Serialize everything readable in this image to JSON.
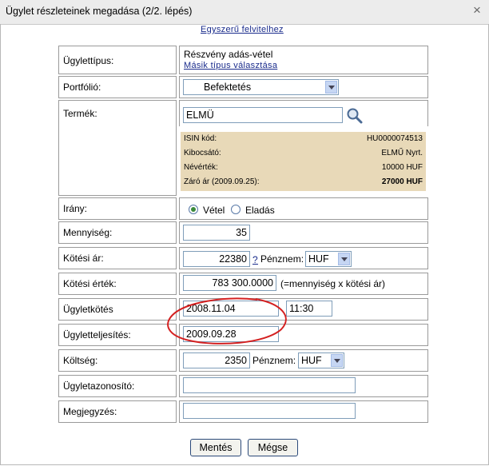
{
  "window": {
    "title": "Ügylet részleteinek megadása (2/2. lépés)",
    "close": "×"
  },
  "simple_link": "Egyszerű felvitelhez",
  "fields": {
    "type": {
      "label": "Ügylettípus:",
      "value": "Részvény adás-vétel",
      "link": "Másik típus választása"
    },
    "portfolio": {
      "label": "Portfólió:",
      "value": "Befektetés"
    },
    "product": {
      "label": "Termék:",
      "value": "ELMÜ"
    },
    "direction": {
      "label": "Irány:",
      "buy": "Vétel",
      "sell": "Eladás",
      "selected": "buy"
    },
    "quantity": {
      "label": "Mennyiség:",
      "value": "35"
    },
    "price": {
      "label": "Kötési ár:",
      "value": "22380",
      "help": "?",
      "currency_label": "Pénznem:",
      "currency": "HUF"
    },
    "amount": {
      "label": "Kötési érték:",
      "value": "783 300.0000",
      "note": "(=mennyiség x kötési ár)"
    },
    "trade_date": {
      "label": "Ügyletkötés",
      "date": "2008.11.04",
      "time": "11:30"
    },
    "settle_date": {
      "label": "Ügyletteljesítés:",
      "date": "2009.09.28"
    },
    "cost": {
      "label": "Költség:",
      "value": "2350",
      "currency_label": "Pénznem:",
      "currency": "HUF"
    },
    "trade_id": {
      "label": "Ügyletazonosító:",
      "value": ""
    },
    "note": {
      "label": "Megjegyzés:",
      "value": ""
    }
  },
  "info": {
    "isin_label": "ISIN kód:",
    "isin": "HU0000074513",
    "issuer_label": "Kibocsátó:",
    "issuer": "ELMŰ Nyrt.",
    "nominal_label": "Névérték:",
    "nominal": "10000 HUF",
    "close_label": "Záró ár (2009.09.25):",
    "close": "27000 HUF"
  },
  "buttons": {
    "save": "Mentés",
    "cancel": "Mégse"
  },
  "colors": {
    "annotation": "#d42020",
    "info_bg": "#e8d9b8",
    "link": "#1a2c8c"
  }
}
